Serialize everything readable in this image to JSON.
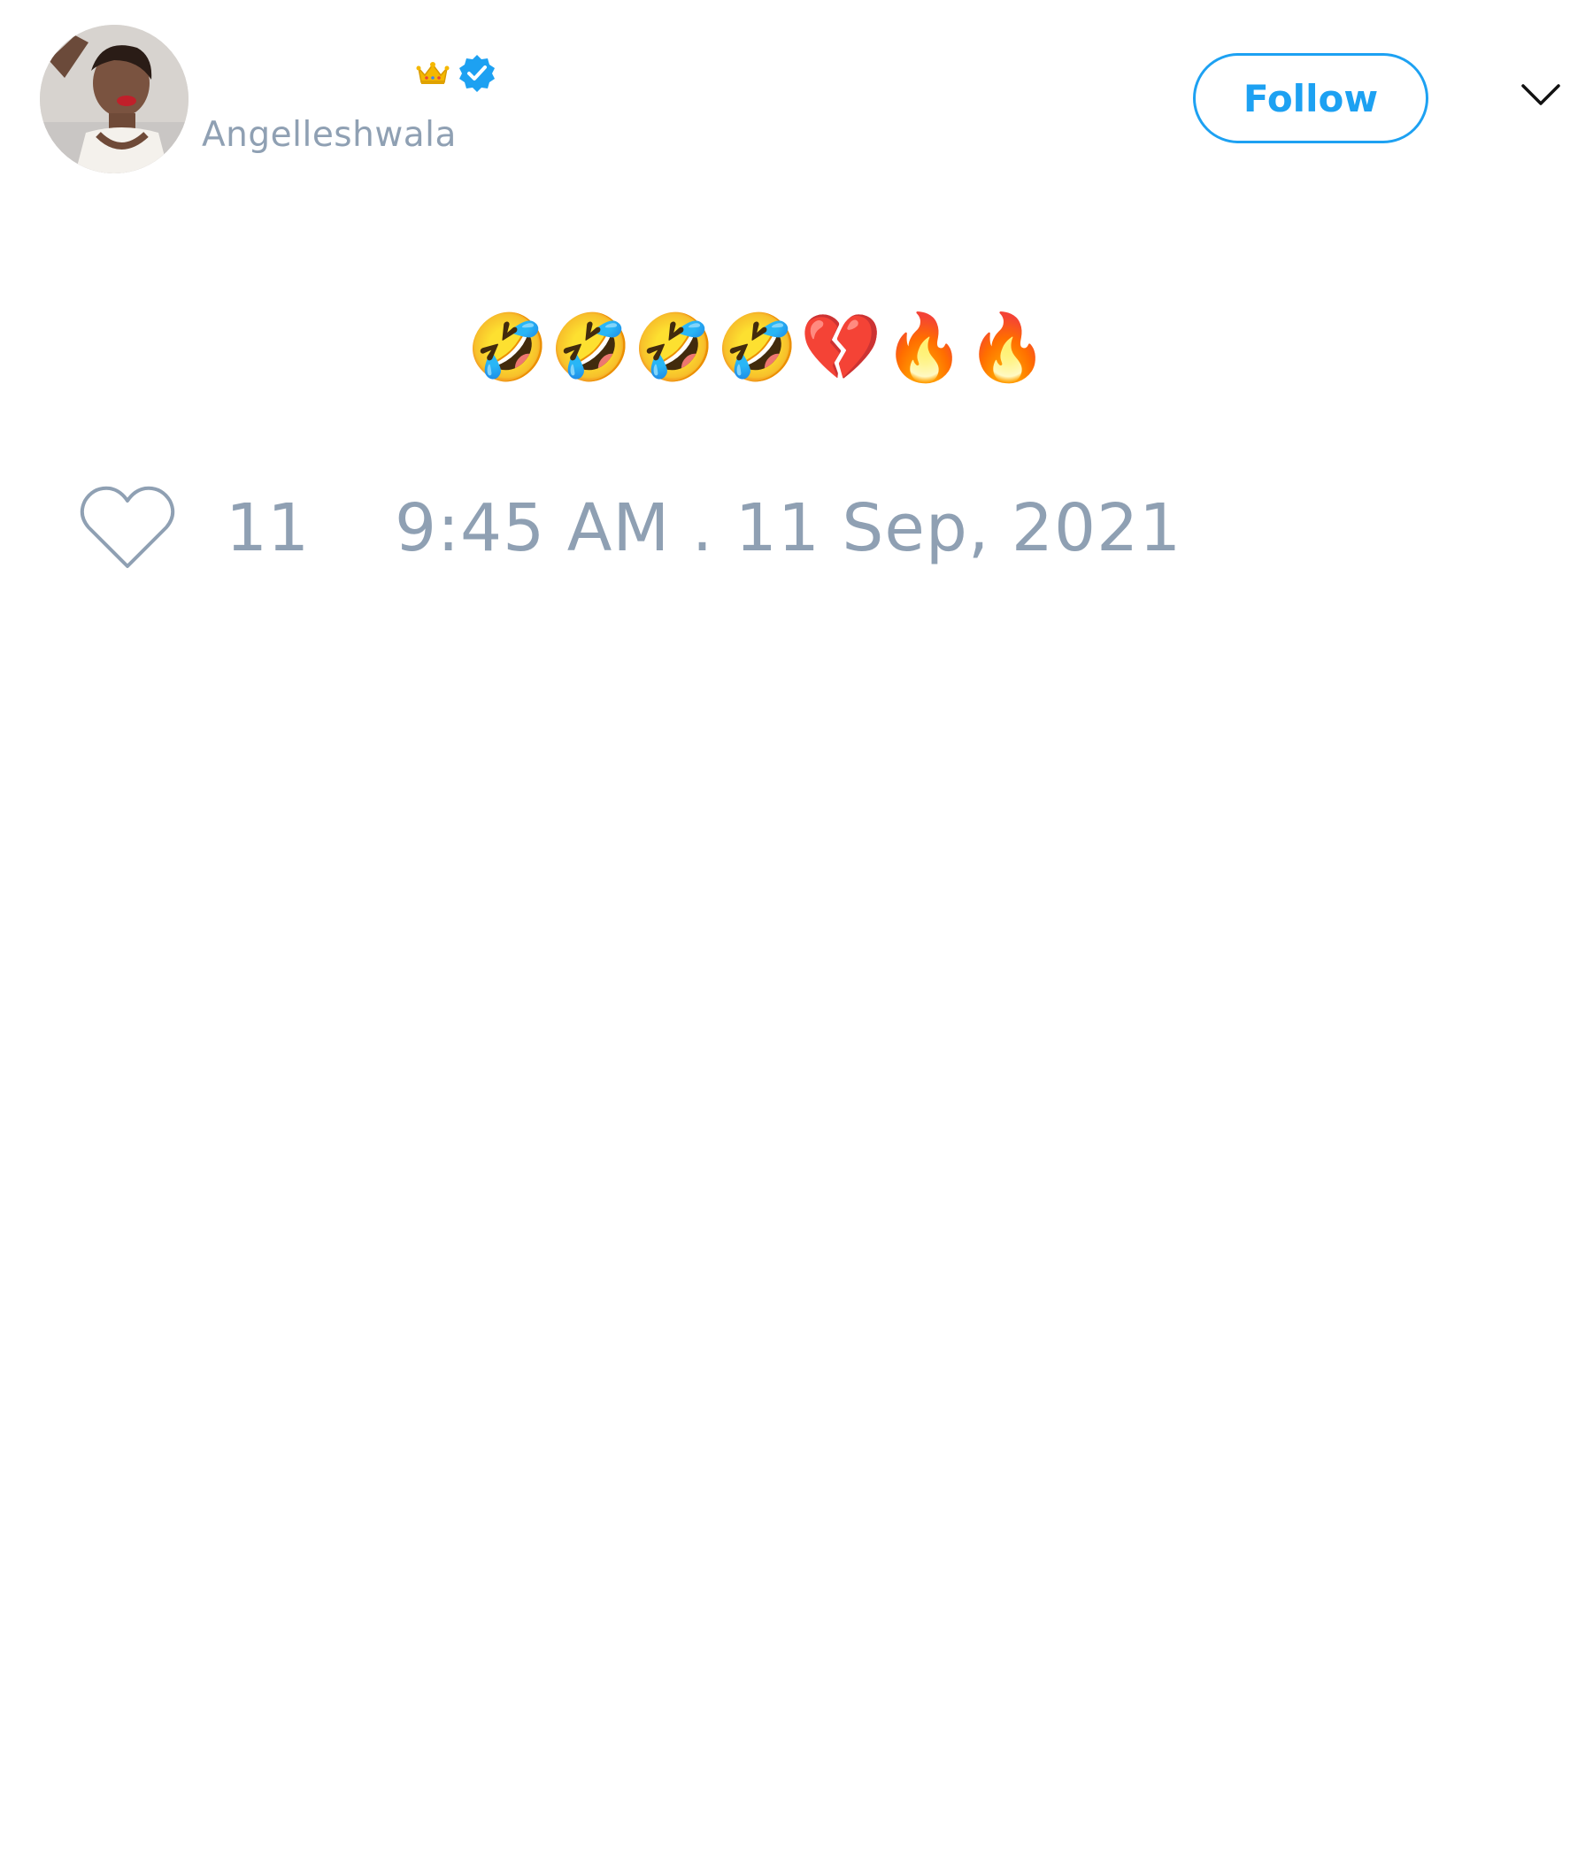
{
  "tweet": {
    "author": {
      "display_name": "",
      "handle": "Angelleshwala",
      "badge_icons": [
        "crown-icon",
        "verified-badge-icon"
      ]
    },
    "follow_label": "Follow",
    "menu_icon": "chevron-down-icon",
    "text": "🤣🤣🤣🤣💔🔥🔥",
    "like_icon": "heart-outline-icon",
    "like_count": "11",
    "timestamp": "9:45 AM . 11 Sep, 2021"
  },
  "colors": {
    "accent": "#1da1f2",
    "muted_text": "#8fa0b3",
    "background": "#ffffff"
  }
}
